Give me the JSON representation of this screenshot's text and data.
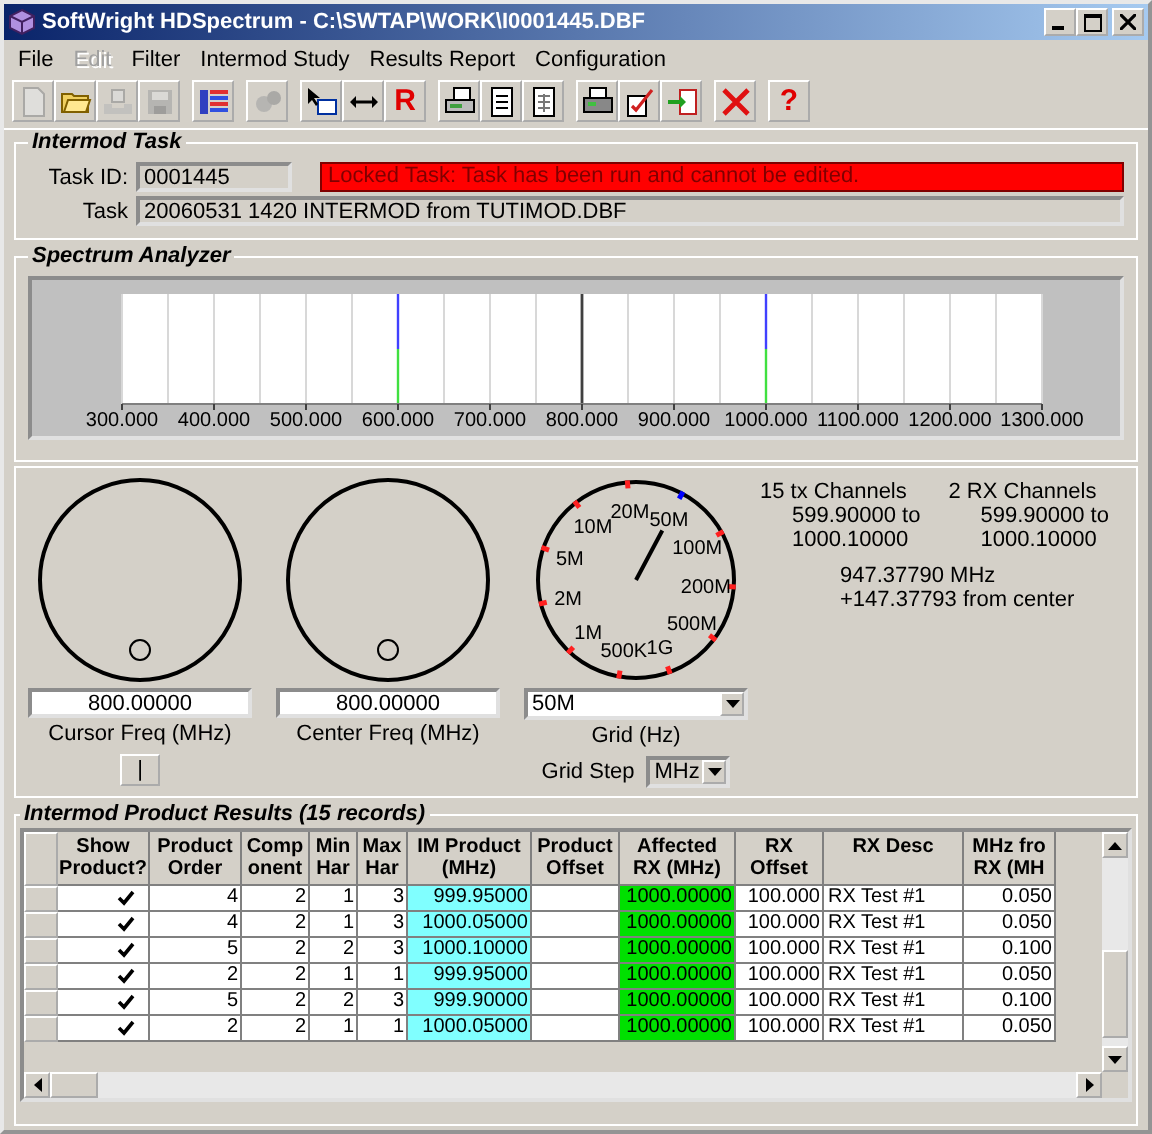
{
  "window": {
    "title": "SoftWright HDSpectrum - C:\\SWTAP\\WORK\\I0001445.DBF"
  },
  "menu": [
    {
      "label": "File",
      "disabled": false
    },
    {
      "label": "Edit",
      "disabled": true
    },
    {
      "label": "Filter",
      "disabled": false
    },
    {
      "label": "Intermod Study",
      "disabled": false
    },
    {
      "label": "Results Report",
      "disabled": false
    },
    {
      "label": "Configuration",
      "disabled": false
    }
  ],
  "toolbar": [
    [
      {
        "kind": "page",
        "disabled": true
      },
      {
        "kind": "folder",
        "disabled": false
      },
      {
        "kind": "tray",
        "disabled": true
      },
      {
        "kind": "disk",
        "disabled": true
      }
    ],
    [
      {
        "kind": "bars",
        "disabled": false
      }
    ],
    [
      {
        "kind": "gears",
        "disabled": true
      }
    ],
    [
      {
        "kind": "select",
        "disabled": false
      },
      {
        "kind": "arrows",
        "disabled": false
      },
      {
        "kind": "glyph",
        "label": "R",
        "disabled": false
      }
    ],
    [
      {
        "kind": "printdoc",
        "disabled": false
      },
      {
        "kind": "doc",
        "disabled": false
      },
      {
        "kind": "griddoc",
        "disabled": false
      }
    ],
    [
      {
        "kind": "printer",
        "disabled": false
      },
      {
        "kind": "checkdoc",
        "disabled": false
      },
      {
        "kind": "exitdoc",
        "disabled": false
      }
    ],
    [
      {
        "kind": "cross",
        "disabled": false
      }
    ],
    [
      {
        "kind": "glyph",
        "label": "?",
        "disabled": false
      }
    ]
  ],
  "intermod_task": {
    "title": "Intermod Task",
    "task_id_label": "Task ID:",
    "task_id": "0001445",
    "lock_message": "Locked Task: Task has been run and cannot be edited.",
    "task_label": "Task",
    "task": "20060531 1420 INTERMOD from TUTIMOD.DBF"
  },
  "spectrum": {
    "title": "Spectrum Analyzer",
    "axis_labels": [
      "300.000",
      "400.000",
      "500.000",
      "600.000",
      "700.000",
      "800.000",
      "900.000",
      "1000.000",
      "1100.000",
      "1200.000",
      "1300.000"
    ]
  },
  "controls": {
    "cursor_freq": {
      "value": "800.00000",
      "label": "Cursor Freq (MHz)",
      "button": "|"
    },
    "center_freq": {
      "value": "800.00000",
      "label": "Center Freq (MHz)"
    },
    "grid_dial": [
      {
        "label": "500K",
        "selected": false
      },
      {
        "label": "1M",
        "selected": false
      },
      {
        "label": "2M",
        "selected": false
      },
      {
        "label": "5M",
        "selected": false
      },
      {
        "label": "10M",
        "selected": false
      },
      {
        "label": "20M",
        "selected": false
      },
      {
        "label": "50M",
        "selected": true
      },
      {
        "label": "100M",
        "selected": false
      },
      {
        "label": "200M",
        "selected": false
      },
      {
        "label": "500M",
        "selected": false
      },
      {
        "label": "1G",
        "selected": false
      }
    ],
    "grid": {
      "value": "50M",
      "label": "Grid (Hz)"
    },
    "grid_step": {
      "label": "Grid Step",
      "value": "MHz"
    },
    "tx": {
      "title": "15 tx Channels",
      "from": "599.90000 to",
      "to": "1000.10000"
    },
    "rx": {
      "title": "2 RX Channels",
      "from": "599.90000 to",
      "to": "1000.10000"
    },
    "cursor_info": [
      "947.37790 MHz",
      "+147.37793 from center"
    ]
  },
  "results": {
    "title": "Intermod Product Results (15 records)",
    "columns": [
      {
        "label": "Show\nProduct?",
        "kind": "check"
      },
      {
        "label": "Product\nOrder",
        "kind": "num"
      },
      {
        "label": "Comp\nonent",
        "kind": "num"
      },
      {
        "label": "Min\nHar",
        "kind": "num"
      },
      {
        "label": "Max\nHar",
        "kind": "num"
      },
      {
        "label": "IM Product\n(MHz)",
        "kind": "num",
        "color": "#80ffff"
      },
      {
        "label": "Product\nOffset",
        "kind": "blank"
      },
      {
        "label": "Affected\nRX (MHz)",
        "kind": "num",
        "color": "#00e000"
      },
      {
        "label": "RX\nOffset",
        "kind": "num"
      },
      {
        "label": "RX Desc",
        "kind": "text"
      },
      {
        "label": "MHz fro\nRX (MH",
        "kind": "num"
      }
    ],
    "rows": [
      {
        "show_product": true,
        "cells": [
          "",
          "4",
          "2",
          "1",
          "3",
          "999.95000",
          "",
          "1000.00000",
          "100.000",
          "RX Test #1",
          "0.050"
        ]
      },
      {
        "show_product": true,
        "cells": [
          "",
          "4",
          "2",
          "1",
          "3",
          "1000.05000",
          "",
          "1000.00000",
          "100.000",
          "RX Test #1",
          "0.050"
        ]
      },
      {
        "show_product": true,
        "cells": [
          "",
          "5",
          "2",
          "2",
          "3",
          "1000.10000",
          "",
          "1000.00000",
          "100.000",
          "RX Test #1",
          "0.100"
        ]
      },
      {
        "show_product": true,
        "cells": [
          "",
          "2",
          "2",
          "1",
          "1",
          "999.95000",
          "",
          "1000.00000",
          "100.000",
          "RX Test #1",
          "0.050"
        ]
      },
      {
        "show_product": true,
        "cells": [
          "",
          "5",
          "2",
          "2",
          "3",
          "999.90000",
          "",
          "1000.00000",
          "100.000",
          "RX Test #1",
          "0.100"
        ]
      },
      {
        "show_product": true,
        "cells": [
          "",
          "2",
          "2",
          "1",
          "1",
          "1000.05000",
          "",
          "1000.00000",
          "100.000",
          "RX Test #1",
          "0.050"
        ]
      }
    ]
  }
}
